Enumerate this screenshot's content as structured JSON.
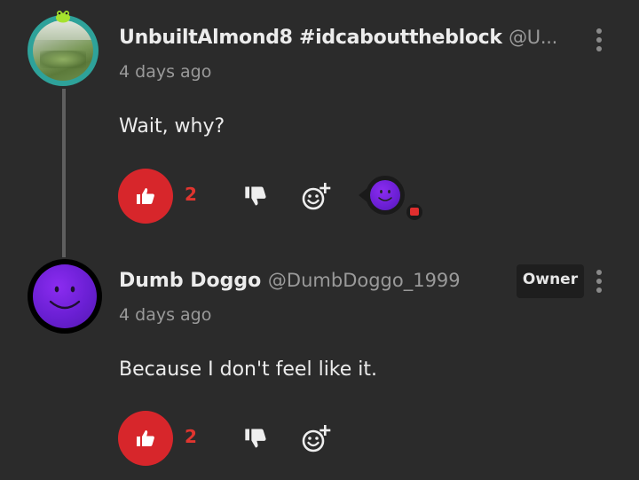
{
  "thread_line_color": "#5f5f5f",
  "accent_color": "#d7262b",
  "comments": [
    {
      "username": "UnbuiltAlmond8 #idcabouttheblock",
      "handle": "@U...",
      "timestamp": "4 days ago",
      "body": "Wait, why?",
      "like_count": "2",
      "avatar_icon": "photo-avatar-with-frog-badge",
      "has_reply_avatar": true
    },
    {
      "username": "Dumb Doggo",
      "handle": "@DumbDoggo_1999",
      "badge": "Owner",
      "timestamp": "4 days ago",
      "body": "Because I don't feel like it.",
      "like_count": "2",
      "avatar_icon": "purple-smiley-avatar"
    }
  ],
  "icons": {
    "like": "thumbs-up-icon",
    "dislike": "thumbs-down-icon",
    "reply": "add-reaction-icon",
    "menu": "more-vertical-icon"
  }
}
